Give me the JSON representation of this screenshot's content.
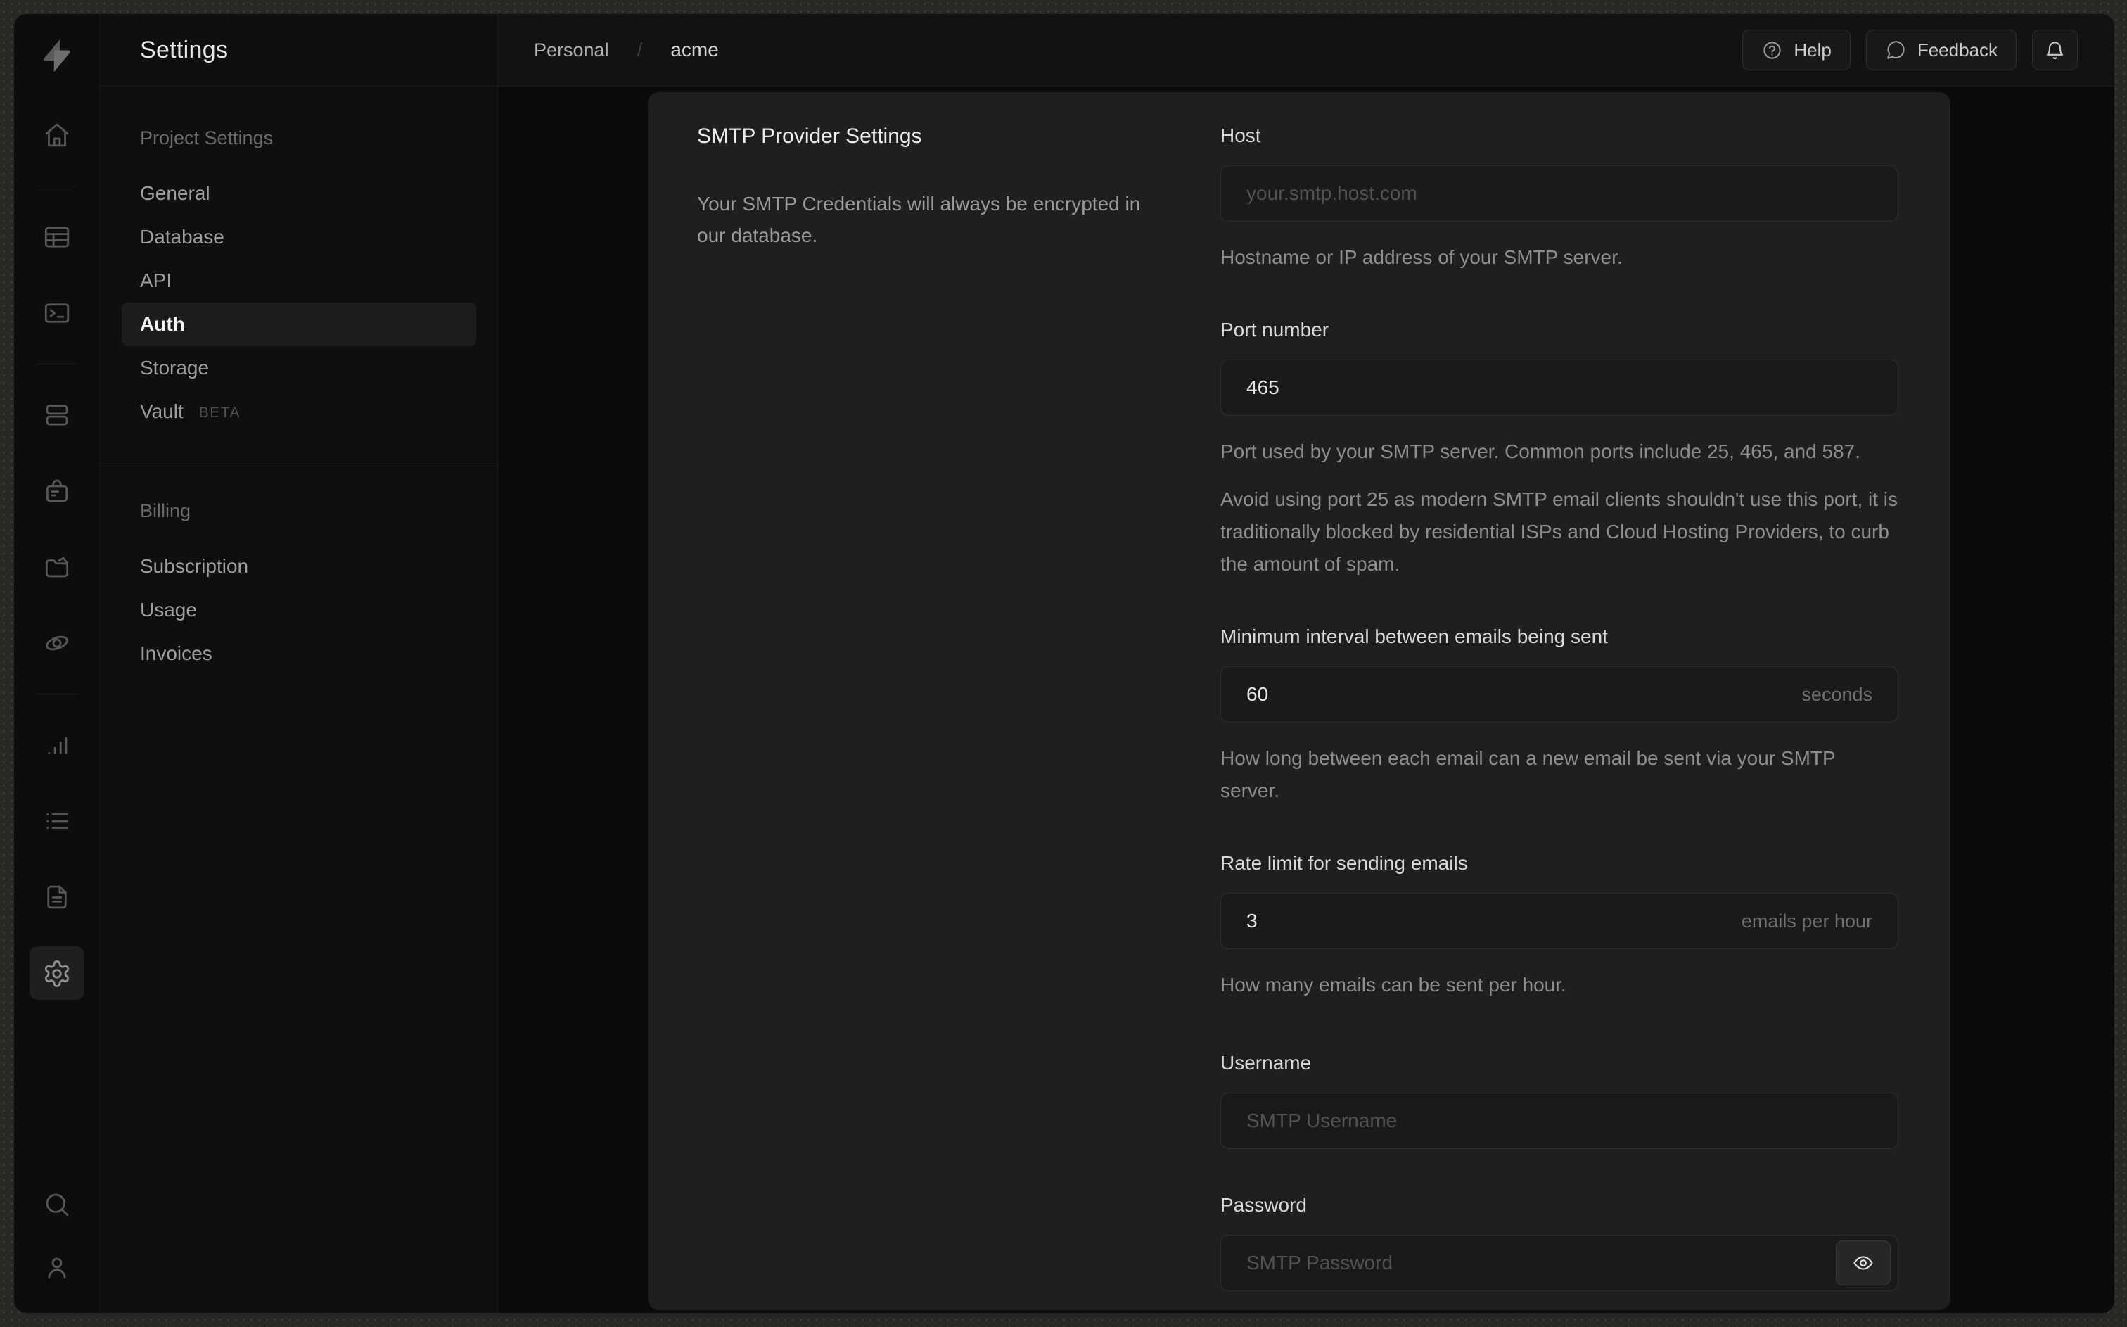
{
  "colors": {
    "desktop": "#272925",
    "window_bg": "#0c0c0c",
    "panel_bg": "#1f1f1f",
    "input_bg": "#1a1a1a",
    "active_row_bg": "#1d1d1d"
  },
  "breadcrumb": {
    "org": "Personal",
    "separator": "/",
    "project": "acme"
  },
  "topbar": {
    "help_label": "Help",
    "feedback_label": "Feedback"
  },
  "nav": {
    "title": "Settings",
    "sections": [
      {
        "header": "Project Settings",
        "items": [
          {
            "label": "General"
          },
          {
            "label": "Database"
          },
          {
            "label": "API"
          },
          {
            "label": "Auth",
            "active": true
          },
          {
            "label": "Storage"
          },
          {
            "label": "Vault",
            "badge": "BETA"
          }
        ]
      },
      {
        "header": "Billing",
        "items": [
          {
            "label": "Subscription"
          },
          {
            "label": "Usage"
          },
          {
            "label": "Invoices"
          }
        ]
      }
    ]
  },
  "rail_icons": [
    "supabase-logo",
    "home",
    "table-editor",
    "sql-editor",
    "database",
    "auth",
    "storage",
    "edge-functions",
    "reports",
    "logs",
    "docs",
    "settings",
    "search",
    "profile"
  ],
  "panel": {
    "title": "SMTP Provider Settings",
    "description": "Your SMTP Credentials will always be encrypted in our database.",
    "fields": {
      "host": {
        "label": "Host",
        "placeholder": "your.smtp.host.com",
        "helper": "Hostname or IP address of your SMTP server."
      },
      "port": {
        "label": "Port number",
        "value": "465",
        "helper": "Port used by your SMTP server. Common ports include 25, 465, and 587.",
        "note": "Avoid using port 25 as modern SMTP email clients shouldn't use this port, it is traditionally blocked by residential ISPs and Cloud Hosting Providers, to curb the amount of spam."
      },
      "interval": {
        "label": "Minimum interval between emails being sent",
        "value": "60",
        "suffix": "seconds",
        "helper": "How long between each email can a new email be sent via your SMTP server."
      },
      "rate": {
        "label": "Rate limit for sending emails",
        "value": "3",
        "suffix": "emails per hour",
        "helper": "How many emails can be sent per hour."
      },
      "username": {
        "label": "Username",
        "placeholder": "SMTP Username"
      },
      "password": {
        "label": "Password",
        "placeholder": "SMTP Password"
      }
    }
  }
}
